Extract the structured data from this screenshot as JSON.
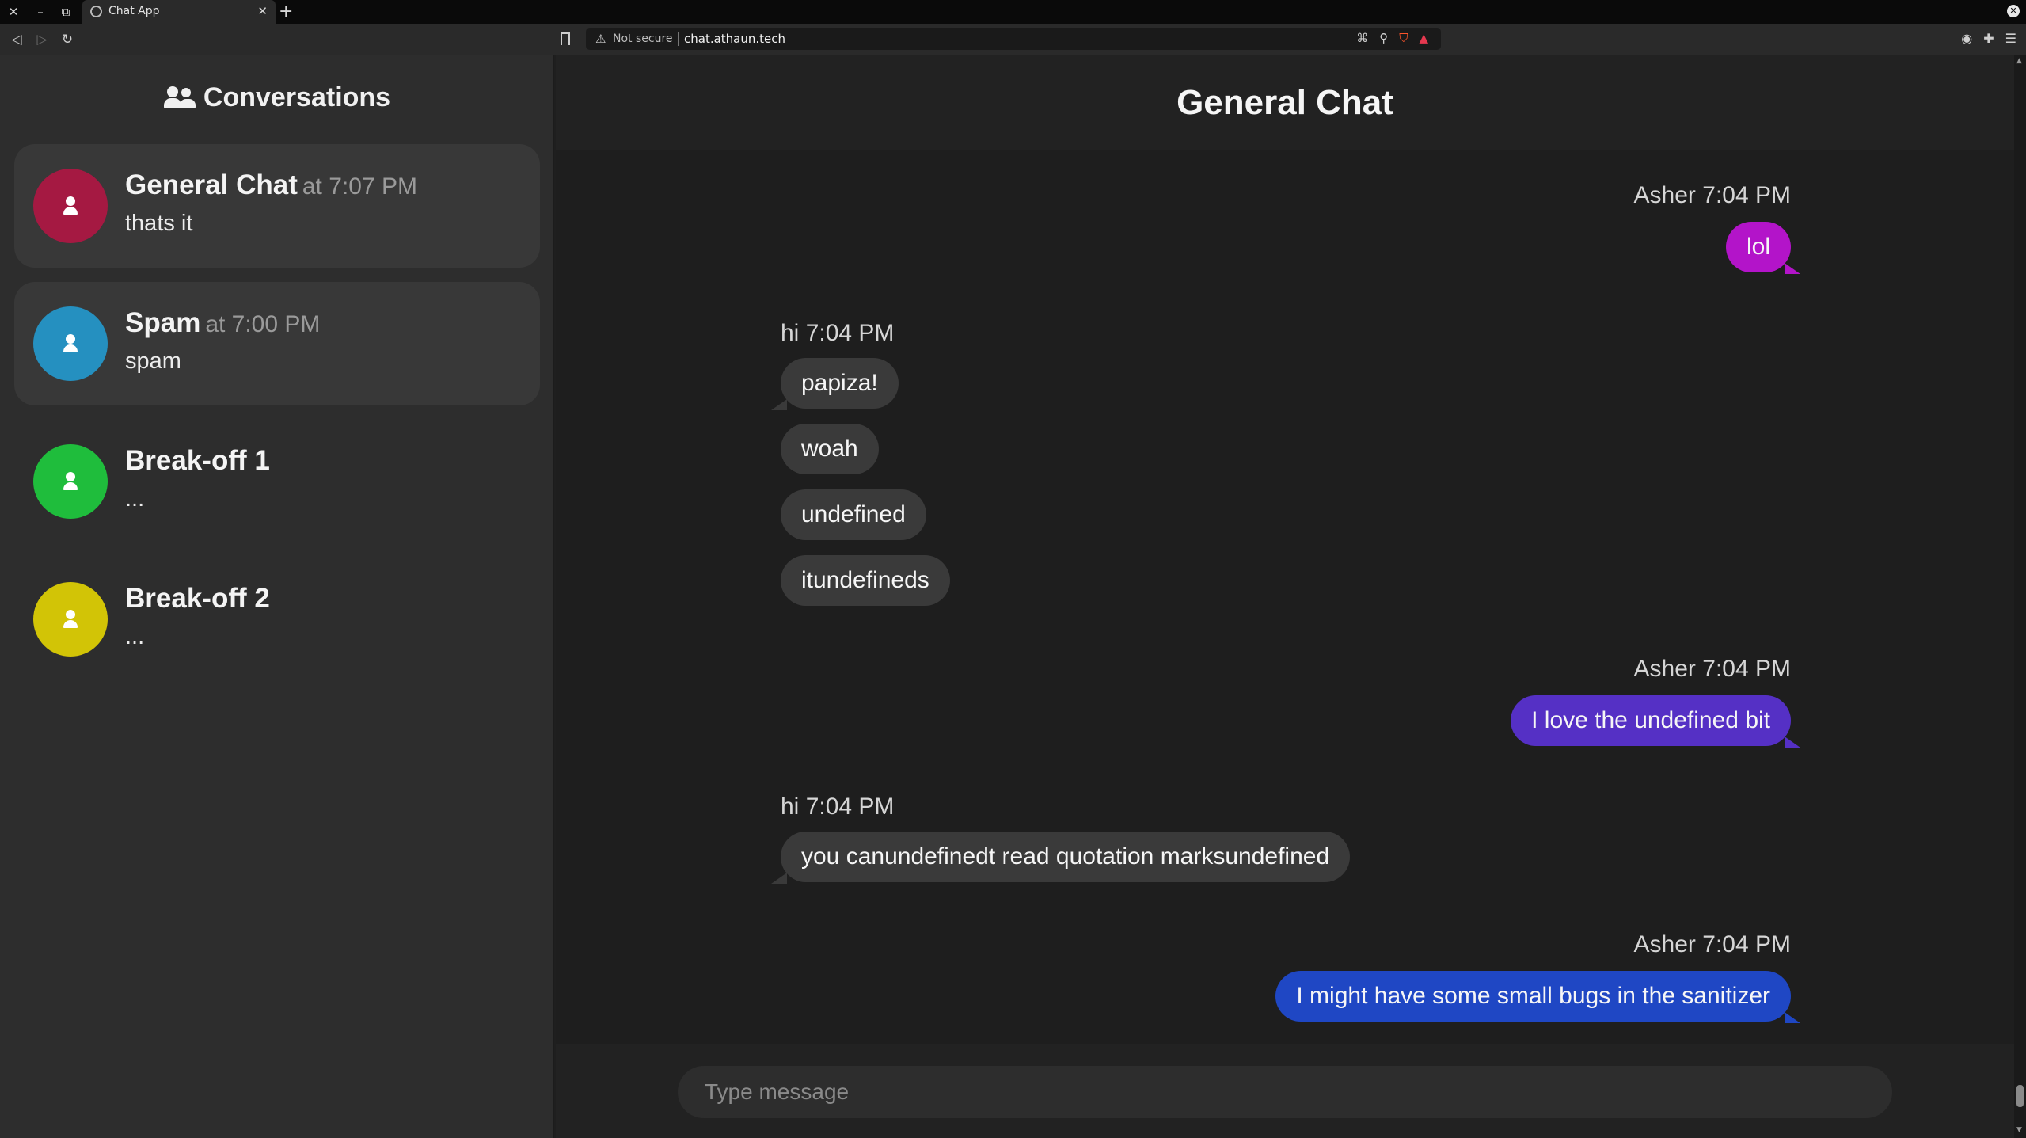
{
  "browser": {
    "tab_title": "Chat App",
    "security_label": "Not secure",
    "url": "chat.athaun.tech"
  },
  "sidebar": {
    "title": "Conversations",
    "conversations": [
      {
        "name": "General Chat",
        "time": "at 7:07 PM",
        "preview": "thats it",
        "color": "#a51942",
        "active": true
      },
      {
        "name": "Spam",
        "time": "at 7:00 PM",
        "preview": "spam",
        "color": "#2590c0",
        "active": true
      },
      {
        "name": "Break-off 1",
        "time": "",
        "preview": "...",
        "color": "#1fbd3c",
        "active": false
      },
      {
        "name": "Break-off 2",
        "time": "",
        "preview": "...",
        "color": "#d2c406",
        "active": false
      }
    ]
  },
  "chat": {
    "title": "General Chat",
    "messages": [
      {
        "sender": "Asher",
        "time": "7:04 PM",
        "direction": "out",
        "texts": [
          "lol"
        ],
        "color": "#b314c9"
      },
      {
        "sender": "hi",
        "time": "7:04 PM",
        "direction": "in",
        "texts": [
          "papiza!",
          "woah",
          "undefined",
          "itundefineds"
        ]
      },
      {
        "sender": "Asher",
        "time": "7:04 PM",
        "direction": "out",
        "texts": [
          "I love the undefined bit"
        ],
        "color": "#5530c5"
      },
      {
        "sender": "hi",
        "time": "7:04 PM",
        "direction": "in",
        "texts": [
          "you canundefinedt read quotation marksundefined"
        ]
      },
      {
        "sender": "Asher",
        "time": "7:04 PM",
        "direction": "out",
        "texts": [
          "I might have some small bugs in the sanitizer"
        ],
        "color": "#1f47c4"
      }
    ],
    "input_placeholder": "Type message"
  },
  "colors": {
    "sidebar_bg": "#2d2d2d",
    "chat_bg": "#1e1e1e",
    "incoming_bubble": "#3a3a3a"
  }
}
